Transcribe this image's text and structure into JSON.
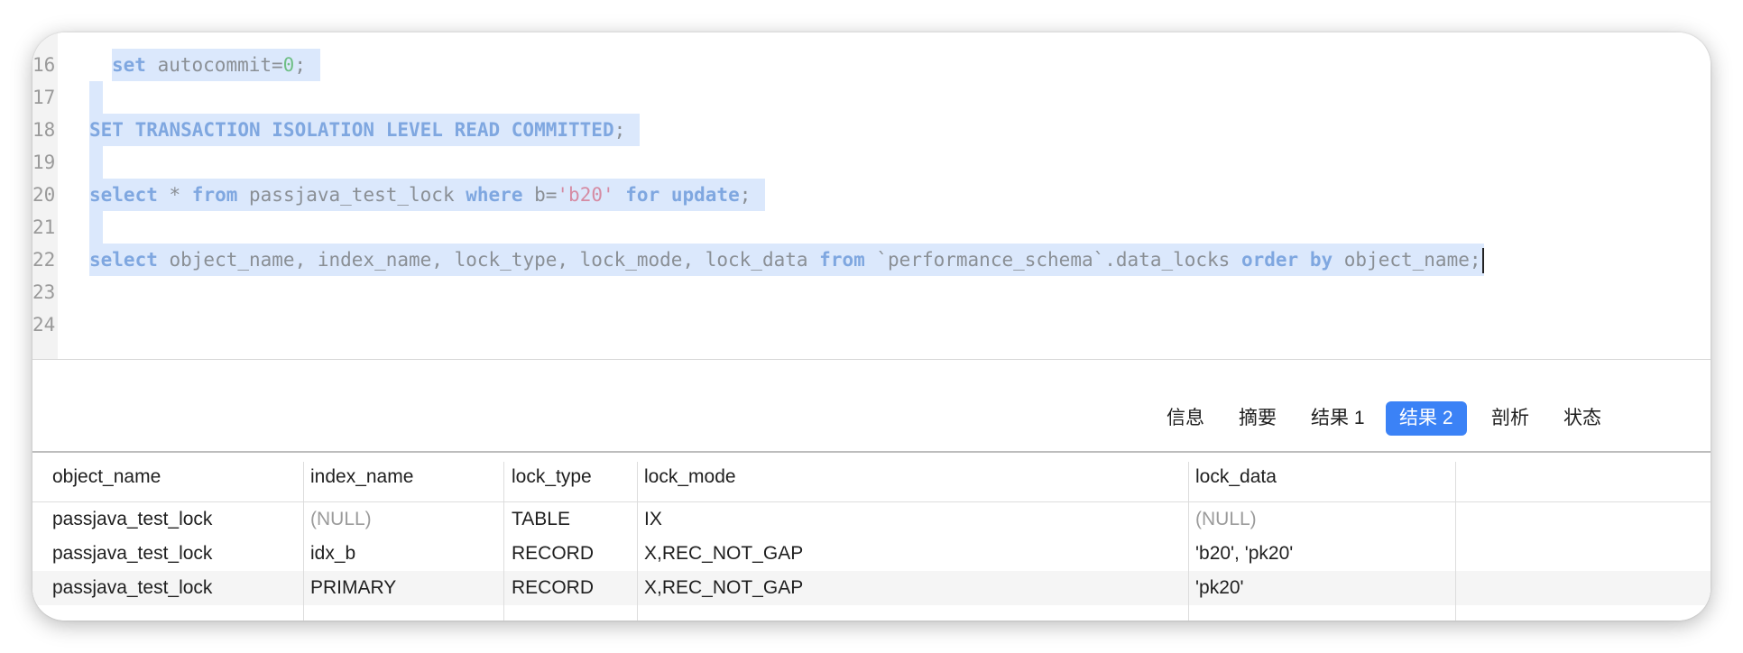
{
  "editor": {
    "lines": [
      {
        "num": "16"
      },
      {
        "num": "17"
      },
      {
        "num": "18"
      },
      {
        "num": "19"
      },
      {
        "num": "20"
      },
      {
        "num": "21"
      },
      {
        "num": "22"
      },
      {
        "num": "23"
      },
      {
        "num": "24"
      }
    ],
    "line16": {
      "kw1": "set",
      "t1": " autocommit=",
      "n1": "0",
      "t2": ";"
    },
    "line18": {
      "kw1": "SET TRANSACTION ISOLATION LEVEL READ COMMITTED",
      "t1": ";"
    },
    "line20": {
      "kw1": "select",
      "t1": " * ",
      "kw2": "from",
      "t2": " passjava_test_lock ",
      "kw3": "where",
      "t3": " b=",
      "s1": "'b20'",
      "t4": " ",
      "kw4": "for update",
      "t5": ";"
    },
    "line22": {
      "kw1": "select",
      "t1": " object_name, index_name, lock_type, lock_mode, lock_data ",
      "kw2": "from",
      "t2": " `performance_schema`.data_locks ",
      "kw3": "order by",
      "t3": " object_name;"
    }
  },
  "tabs": [
    {
      "label": "信息"
    },
    {
      "label": "摘要"
    },
    {
      "label": "结果 1"
    },
    {
      "label": "结果 2",
      "active": true
    },
    {
      "label": "剖析"
    },
    {
      "label": "状态"
    }
  ],
  "grid": {
    "columns": [
      "object_name",
      "index_name",
      "lock_type",
      "lock_mode",
      "lock_data"
    ],
    "rows": [
      [
        "passjava_test_lock",
        "(NULL)",
        "TABLE",
        "IX",
        "(NULL)"
      ],
      [
        "passjava_test_lock",
        "idx_b",
        "RECORD",
        "X,REC_NOT_GAP",
        "'b20', 'pk20'"
      ],
      [
        "passjava_test_lock",
        "PRIMARY",
        "RECORD",
        "X,REC_NOT_GAP",
        "'pk20'"
      ]
    ]
  },
  "colors": {
    "accent": "#3b82f6",
    "selection": "#dbe8fc",
    "keyword": "#7fa7e0",
    "string": "#d58ba3",
    "number": "#6fbf86"
  }
}
